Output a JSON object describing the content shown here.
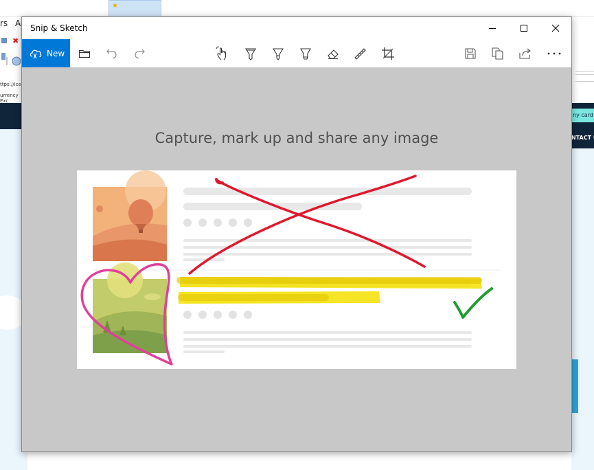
{
  "background_app": {
    "menu_fragment_1": "rs",
    "menu_fragment_2": "Ad",
    "address_fragment": "ttps://ice-u",
    "favorites_fragment": "urrency Exc",
    "any_card": "ny card",
    "contact": "NTACT U"
  },
  "window": {
    "title": "Snip & Sketch"
  },
  "window_controls": {
    "minimize_icon": "minimize-icon",
    "maximize_icon": "maximize-icon",
    "close_icon": "close-icon"
  },
  "toolbar": {
    "new_label": "New",
    "icons": [
      "new-snip-icon",
      "open-folder-icon",
      "undo-icon",
      "redo-icon",
      "touch-writing-icon",
      "ballpoint-pen-icon",
      "pencil-icon",
      "highlighter-icon",
      "eraser-icon",
      "ruler-icon",
      "crop-icon",
      "save-icon",
      "copy-icon",
      "share-icon",
      "more-options-icon"
    ]
  },
  "canvas": {
    "headline": "Capture, mark up and share any image"
  },
  "colors": {
    "accent": "#0078d7",
    "canvas_bg": "#c8c8c8",
    "red_mark": "#e0182d",
    "yellow_highlight": "#f5e000",
    "pink_heart": "#e0409a",
    "green_check": "#1e9e2e"
  }
}
